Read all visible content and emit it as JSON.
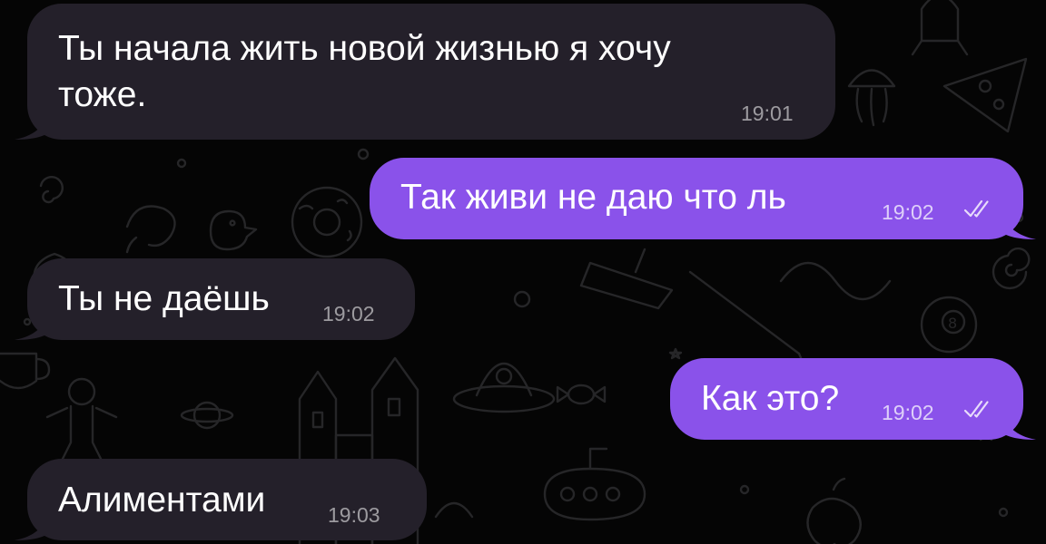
{
  "colors": {
    "background": "#050505",
    "incoming_bubble": "#24202a",
    "outgoing_bubble": "#8a52ea",
    "text": "#ffffff"
  },
  "messages": [
    {
      "direction": "incoming",
      "text_line1": "Ты начала жить новой жизнью я хочу",
      "text_line2": "тоже.",
      "time": "19:01"
    },
    {
      "direction": "outgoing",
      "text": "Так живи не даю что ль",
      "time": "19:02",
      "status": "read"
    },
    {
      "direction": "incoming",
      "text": "Ты не даёшь",
      "time": "19:02"
    },
    {
      "direction": "outgoing",
      "text": "Как это?",
      "time": "19:02",
      "status": "read"
    },
    {
      "direction": "incoming",
      "text": "Алиментами",
      "time": "19:03"
    }
  ],
  "icons": {
    "read_status": "double-check-icon",
    "wallpaper": "doodle-pattern"
  }
}
